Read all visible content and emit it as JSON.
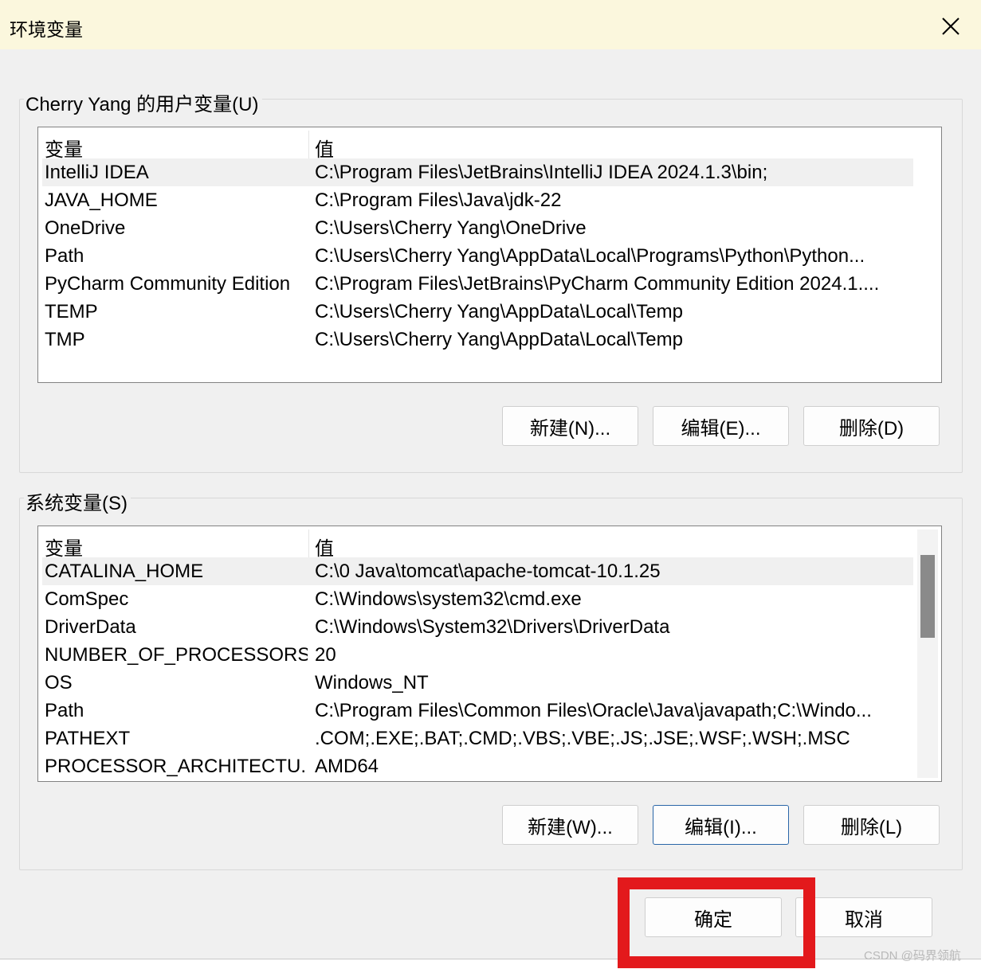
{
  "window": {
    "title": "环境变量"
  },
  "user_vars": {
    "group_label": "Cherry Yang 的用户变量(U)",
    "col_variable": "变量",
    "col_value": "值",
    "rows": [
      {
        "name": "IntelliJ IDEA",
        "value": "C:\\Program Files\\JetBrains\\IntelliJ IDEA 2024.1.3\\bin;"
      },
      {
        "name": "JAVA_HOME",
        "value": "C:\\Program Files\\Java\\jdk-22"
      },
      {
        "name": "OneDrive",
        "value": "C:\\Users\\Cherry Yang\\OneDrive"
      },
      {
        "name": "Path",
        "value": "C:\\Users\\Cherry Yang\\AppData\\Local\\Programs\\Python\\Python..."
      },
      {
        "name": "PyCharm Community Edition",
        "value": "C:\\Program Files\\JetBrains\\PyCharm Community Edition 2024.1...."
      },
      {
        "name": "TEMP",
        "value": "C:\\Users\\Cherry Yang\\AppData\\Local\\Temp"
      },
      {
        "name": "TMP",
        "value": "C:\\Users\\Cherry Yang\\AppData\\Local\\Temp"
      }
    ],
    "new_label": "新建(N)...",
    "edit_label": "编辑(E)...",
    "delete_label": "删除(D)"
  },
  "system_vars": {
    "group_label": "系统变量(S)",
    "col_variable": "变量",
    "col_value": "值",
    "rows": [
      {
        "name": "CATALINA_HOME",
        "value": "C:\\0 Java\\tomcat\\apache-tomcat-10.1.25"
      },
      {
        "name": "ComSpec",
        "value": "C:\\Windows\\system32\\cmd.exe"
      },
      {
        "name": "DriverData",
        "value": "C:\\Windows\\System32\\Drivers\\DriverData"
      },
      {
        "name": "NUMBER_OF_PROCESSORS",
        "value": "20"
      },
      {
        "name": "OS",
        "value": "Windows_NT"
      },
      {
        "name": "Path",
        "value": "C:\\Program Files\\Common Files\\Oracle\\Java\\javapath;C:\\Windo..."
      },
      {
        "name": "PATHEXT",
        "value": ".COM;.EXE;.BAT;.CMD;.VBS;.VBE;.JS;.JSE;.WSF;.WSH;.MSC"
      },
      {
        "name": "PROCESSOR_ARCHITECTU...",
        "value": "AMD64"
      }
    ],
    "new_label": "新建(W)...",
    "edit_label": "编辑(I)...",
    "delete_label": "删除(L)"
  },
  "footer": {
    "ok_label": "确定",
    "cancel_label": "取消"
  },
  "watermark": "CSDN @码界领航",
  "colors": {
    "highlight": "#e3191c",
    "titlebar": "#fbf7dd",
    "focus_border": "#2a66a8"
  }
}
